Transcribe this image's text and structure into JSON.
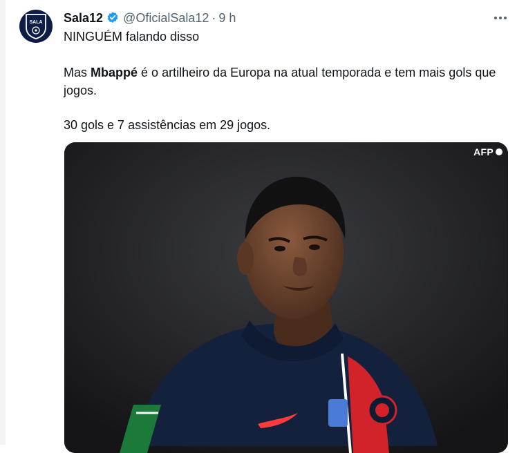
{
  "tweet": {
    "author": {
      "name": "Sala12",
      "handle": "@OficialSala12",
      "verified": true,
      "avatar_label": "SALA"
    },
    "separator": "·",
    "time": "9 h",
    "lines": [
      "NINGUÉM falando disso",
      "Mas",
      "Mbappé",
      " é o artilheiro da Europa na atual temporada e tem mais gols que jogos.",
      "30 gols e 7 assistências em 29 jogos."
    ],
    "media": {
      "watermark": "AFP"
    }
  },
  "colors": {
    "verified": "#1d9bf0",
    "secondary_text": "#536471",
    "avatar_bg": "#0d1d46",
    "jersey": "#14213d",
    "jersey_stripe": "#d2232a"
  },
  "icons": {
    "verified": "verified-badge-icon",
    "more": "more-options-icon"
  }
}
